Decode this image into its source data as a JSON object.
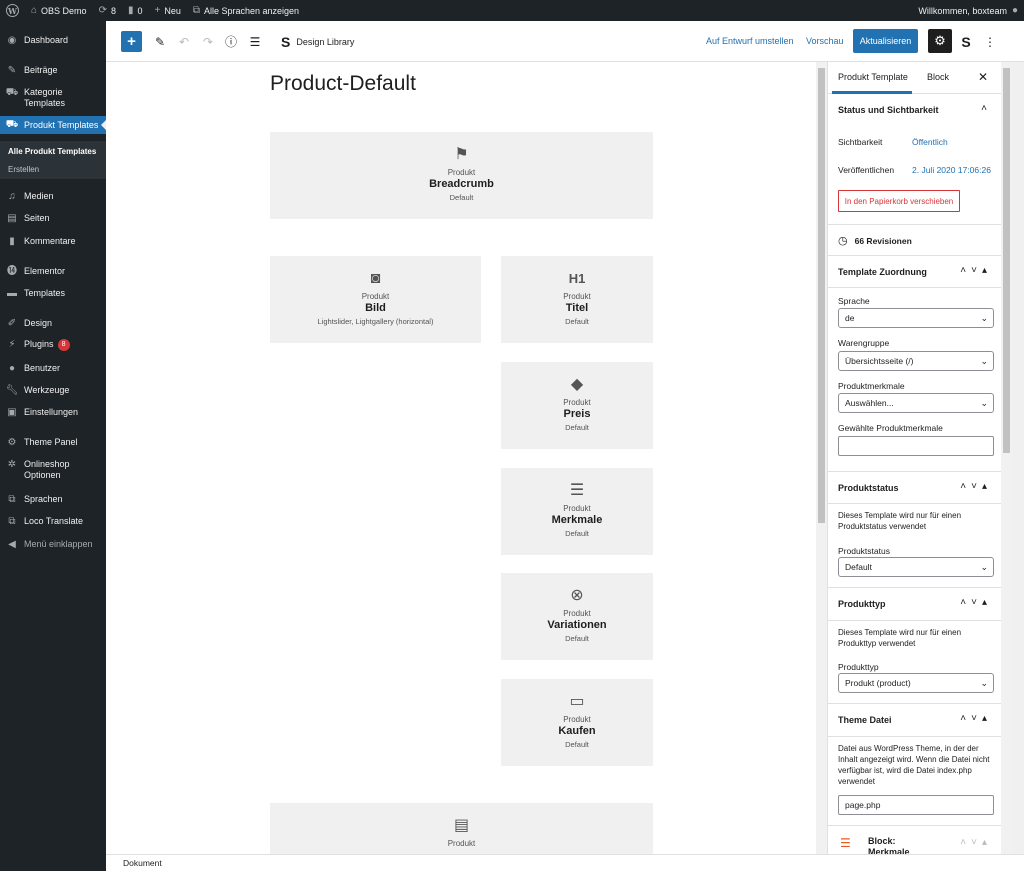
{
  "adminbar": {
    "site_name": "OBS Demo",
    "updates_count": "8",
    "comments_count": "0",
    "new_label": "Neu",
    "languages_label": "Alle Sprachen anzeigen",
    "welcome": "Willkommen, boxteam"
  },
  "menu": {
    "items": [
      {
        "label": "Dashboard",
        "icon": "gauge-icon"
      },
      {
        "label": "Beiträge",
        "icon": "pin-icon"
      },
      {
        "label": "Kategorie Templates",
        "icon": "cart-icon"
      },
      {
        "label": "Produkt Templates",
        "icon": "cart-icon"
      },
      {
        "label": "Medien",
        "icon": "media-icon"
      },
      {
        "label": "Seiten",
        "icon": "page-icon"
      },
      {
        "label": "Kommentare",
        "icon": "comment-icon"
      },
      {
        "label": "Elementor",
        "icon": "elementor-icon"
      },
      {
        "label": "Templates",
        "icon": "folder-icon"
      },
      {
        "label": "Design",
        "icon": "brush-icon"
      },
      {
        "label": "Plugins",
        "icon": "plug-icon",
        "badge": "8"
      },
      {
        "label": "Benutzer",
        "icon": "user-icon"
      },
      {
        "label": "Werkzeuge",
        "icon": "wrench-icon"
      },
      {
        "label": "Einstellungen",
        "icon": "settings-icon"
      },
      {
        "label": "Theme Panel",
        "icon": "gear-icon"
      },
      {
        "label": "Onlineshop Optionen",
        "icon": "wheel-icon"
      },
      {
        "label": "Sprachen",
        "icon": "translate-icon"
      },
      {
        "label": "Loco Translate",
        "icon": "translate-icon"
      },
      {
        "label": "Menü einklappen",
        "icon": "collapse-icon"
      }
    ],
    "submenu": [
      "Alle Produkt Templates",
      "Erstellen"
    ]
  },
  "toolbar": {
    "design_library": "Design Library",
    "draft_link": "Auf Entwurf umstellen",
    "preview_link": "Vorschau",
    "update_button": "Aktualisieren"
  },
  "editor": {
    "title": "Product-Default",
    "blocks": [
      {
        "pre": "Produkt",
        "name": "Breadcrumb",
        "sub": "Default",
        "icon": "signpost-icon"
      },
      {
        "pre": "Produkt",
        "name": "Bild",
        "sub": "Lightslider, Lightgallery (horizontal)",
        "icon": "camera-icon"
      },
      {
        "pre": "Produkt",
        "name": "Titel",
        "sub": "Default",
        "icon": "h1-icon"
      },
      {
        "pre": "Produkt",
        "name": "Preis",
        "sub": "Default",
        "icon": "tag-icon"
      },
      {
        "pre": "Produkt",
        "name": "Merkmale",
        "sub": "Default",
        "icon": "list-icon"
      },
      {
        "pre": "Produkt",
        "name": "Variationen",
        "sub": "Default",
        "icon": "variations-icon"
      },
      {
        "pre": "Produkt",
        "name": "Kaufen",
        "sub": "Default",
        "icon": "buy-icon"
      },
      {
        "pre": "Produkt",
        "icon": "document-icon"
      }
    ]
  },
  "panel": {
    "tab_template": "Produkt Template",
    "tab_block": "Block",
    "status_title": "Status und Sichtbarkeit",
    "visibility_label": "Sichtbarkeit",
    "visibility_value": "Öffentlich",
    "published_label": "Veröffentlichen",
    "published_value": "2. Juli 2020 17:06:26",
    "trash_button": "In den Papierkorb verschieben",
    "revisions": "66 Revisionen",
    "assign_title": "Template Zuordnung",
    "lang_label": "Sprache",
    "lang_value": "de",
    "group_label": "Warengruppe",
    "group_value": "Übersichtsseite (/)",
    "features_label": "Produktmerkmale",
    "features_value": "Auswählen...",
    "chosen_features_label": "Gewählte Produktmerkmale",
    "status_section_title": "Produktstatus",
    "status_desc": "Dieses Template wird nur für einen Produktstatus verwendet",
    "status_label": "Produktstatus",
    "status_value": "Default",
    "type_section_title": "Produkttyp",
    "type_desc": "Dieses Template wird nur für einen Produkttyp verwendet",
    "type_label": "Produkttyp",
    "type_value": "Produkt (product)",
    "theme_title": "Theme Datei",
    "theme_desc": "Datei aus WordPress Theme, in der der Inhalt angezeigt wird. Wenn die Datei nicht verfügbar ist, wird die Datei index.php verwendet",
    "theme_value": "page.php",
    "block_item": "Block: Merkmale"
  },
  "footer": {
    "label": "Dokument"
  }
}
